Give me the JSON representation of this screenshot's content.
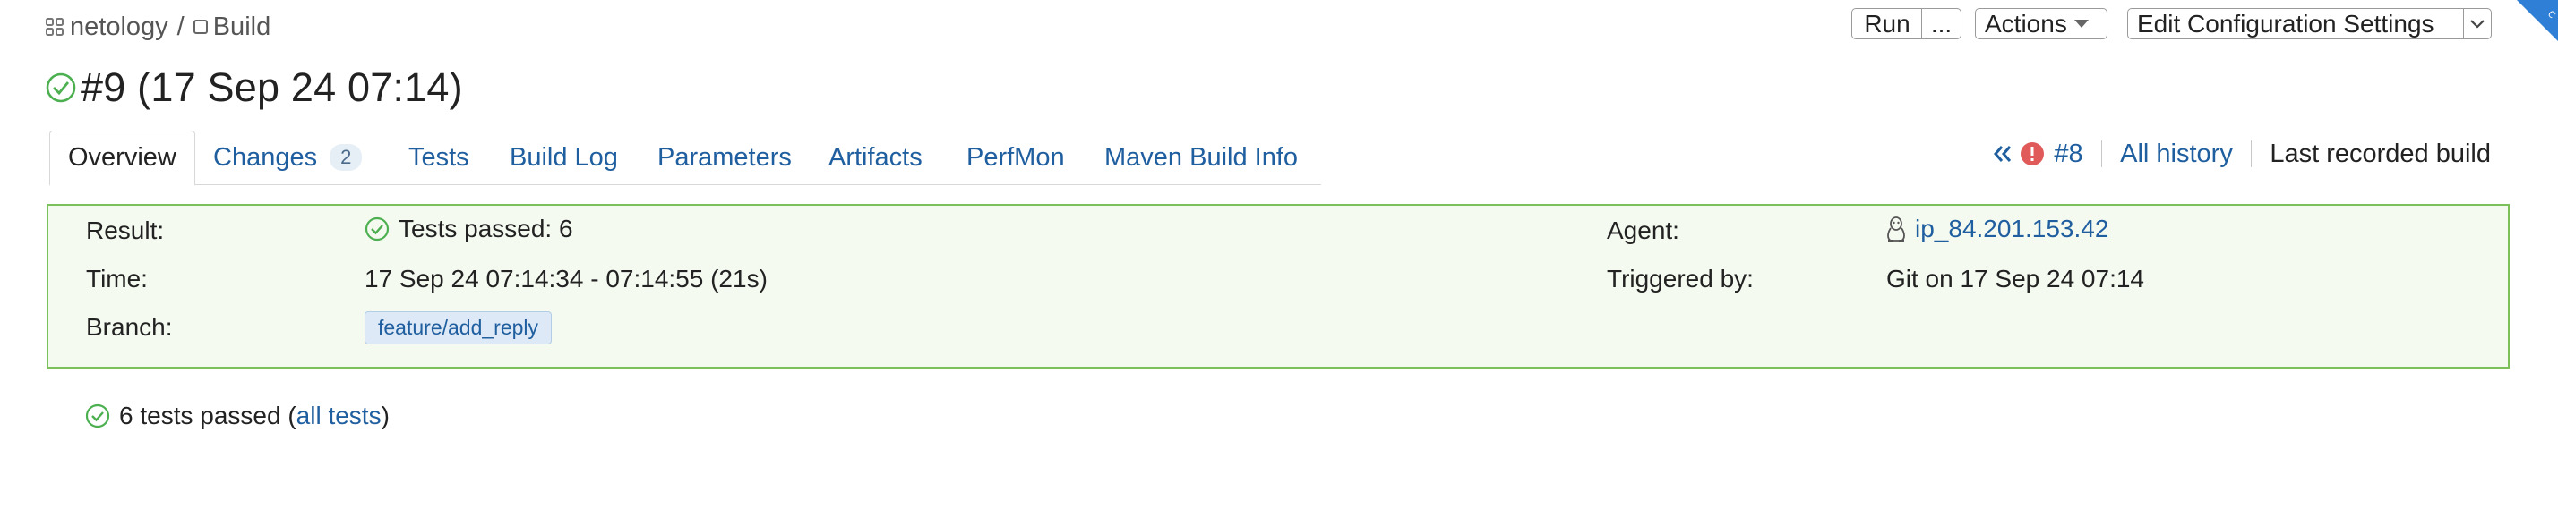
{
  "breadcrumb": {
    "project": "netology",
    "separator": "/",
    "build_config": "Build"
  },
  "toolbar": {
    "run_label": "Run",
    "more_label": "...",
    "actions_label": "Actions",
    "edit_label": "Edit Configuration Settings"
  },
  "build": {
    "title": "#9 (17 Sep 24 07:14)"
  },
  "tabs": [
    {
      "label": "Overview"
    },
    {
      "label": "Changes",
      "count": "2"
    },
    {
      "label": "Tests"
    },
    {
      "label": "Build Log"
    },
    {
      "label": "Parameters"
    },
    {
      "label": "Artifacts"
    },
    {
      "label": "PerfMon"
    },
    {
      "label": "Maven Build Info"
    }
  ],
  "history": {
    "prev_build": "#8",
    "all_history": "All history",
    "last_recorded": "Last recorded build"
  },
  "summary": {
    "result_label": "Result:",
    "result_value": "Tests passed: 6",
    "time_label": "Time:",
    "time_value": "17 Sep 24 07:14:34 - 07:14:55 (21s)",
    "branch_label": "Branch:",
    "branch_value": "feature/add_reply",
    "agent_label": "Agent:",
    "agent_value": "ip_84.201.153.42",
    "triggered_label": "Triggered by:",
    "triggered_value": "Git on 17 Sep 24 07:14"
  },
  "tests": {
    "summary_text": "6 tests passed (",
    "link_text": "all tests",
    "close_paren": ")"
  },
  "colors": {
    "link": "#1f5e9f",
    "success": "#4caf50",
    "summary_border": "#7cc05a",
    "summary_bg": "#f4faf0",
    "error": "#e05a5a",
    "corner_badge": "#2f7fd6"
  }
}
